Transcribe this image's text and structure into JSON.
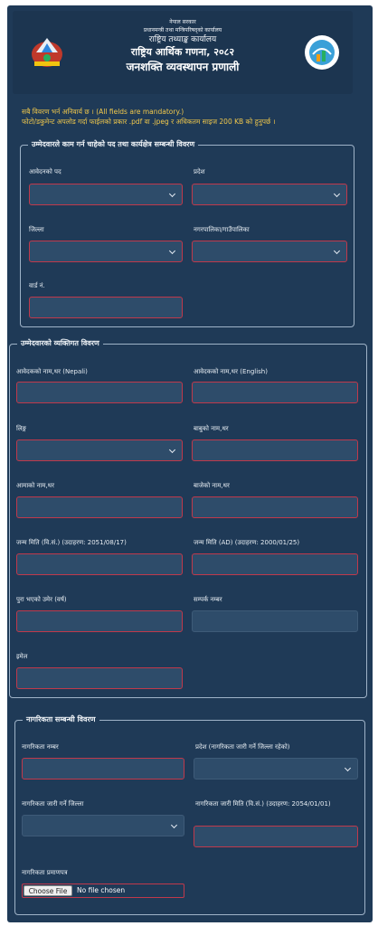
{
  "header": {
    "line1": "नेपाल सरकार",
    "line2": "प्रधानमन्त्री तथा मन्त्रिपरिषद्को कार्यालय",
    "line3": "राष्ट्रिय तथ्याङ्क कार्यालय",
    "line4": "राष्ट्रिय आर्थिक गणना, २०८२",
    "line5": "जनशक्ति व्यवस्थापन प्रणाली"
  },
  "notice": {
    "line1": "सबै विवरण भर्न अनिवार्य छ । (All fields are mandatory.)",
    "line2": "फोटो/डकुमेन्ट अपलोड गर्दा फाईलको प्रकार .pdf वा .jpeg र अधिकतम साइज 200 KB को हुनुपर्छ ।"
  },
  "section1": {
    "title": "उम्मेदवारले काम गर्न चाहेको पद तथा कार्यक्षेत्र सम्बन्धी विवरण",
    "post_label": "आवेदनको पद",
    "province_label": "प्रदेश",
    "district_label": "जिल्ला",
    "municipality_label": "नगरपालिका/गाउँपालिका",
    "ward_label": "वार्ड नं."
  },
  "section2": {
    "title": "उम्मेदवारको व्यक्तिगत विवरण",
    "name_np_label": "आवेदकको नाम,थर (Nepali)",
    "name_en_label": "आवेदकको नाम,थर (English)",
    "gender_label": "लिङ्ग",
    "father_label": "बाबुको नाम,थर",
    "mother_label": "आमाको नाम,थर",
    "grandfather_label": "बाजेको नाम,थर",
    "dob_bs_label": "जन्म मिति (वि.सं.) (उदाहरण: 2051/08/17)",
    "dob_ad_label": "जन्म मिति (AD) (उदाहरण: 2000/01/25)",
    "age_label": "पुरा भएको उमेर (वर्ष)",
    "contact_label": "सम्पर्क नम्बर",
    "email_label": "इमेल"
  },
  "section3": {
    "title": "नागरिकता सम्बन्धी विवरण",
    "citizenship_no_label": "नागरिकता नम्बर",
    "issue_province_label": "प्रदेश (नागरिकता जारी गर्ने जिल्ला रहेको)",
    "issue_district_label": "नागरिकता जारी गर्ने जिल्ला",
    "issue_date_label": "नागरिकता जारी मिति (वि.सं.) (उदाहरण: 2054/01/01)",
    "certificate_label": "नागरिकता प्रमाणपत्र",
    "file_button": "Choose File",
    "file_status": "No file chosen"
  },
  "colors": {
    "background": "#1f3a57",
    "field": "#2e4c6a",
    "invalid_border": "#c0394b",
    "notice": "#f2c94c"
  }
}
